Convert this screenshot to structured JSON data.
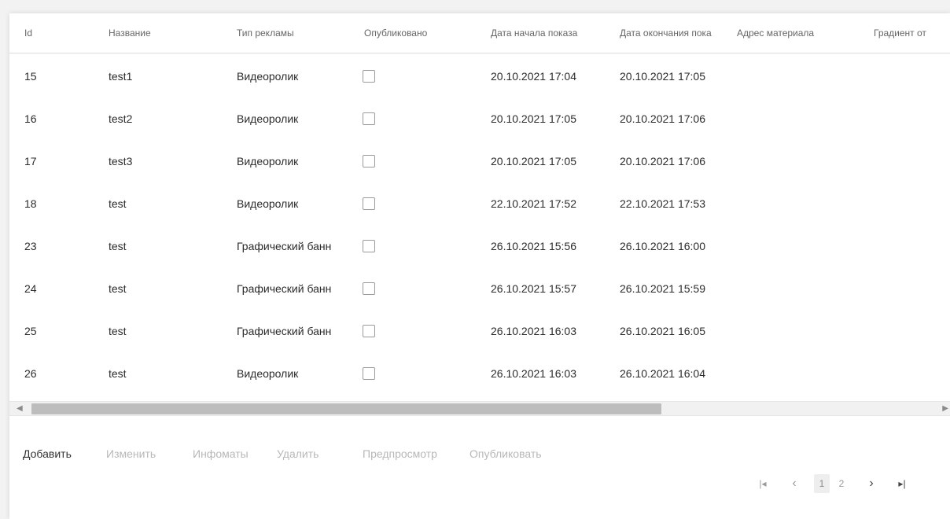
{
  "columns": [
    "Id",
    "Название",
    "Тип рекламы",
    "Опубликовано",
    "Дата начала показа",
    "Дата окончания пока",
    "Адрес материала",
    "Градиент от"
  ],
  "rows": [
    {
      "id": "15",
      "name": "test1",
      "type": "Видеоролик",
      "published": false,
      "start": "20.10.2021 17:04",
      "end": "20.10.2021 17:05",
      "address": "",
      "gradient": ""
    },
    {
      "id": "16",
      "name": "test2",
      "type": "Видеоролик",
      "published": false,
      "start": "20.10.2021 17:05",
      "end": "20.10.2021 17:06",
      "address": "",
      "gradient": ""
    },
    {
      "id": "17",
      "name": "test3",
      "type": "Видеоролик",
      "published": false,
      "start": "20.10.2021 17:05",
      "end": "20.10.2021 17:06",
      "address": "",
      "gradient": ""
    },
    {
      "id": "18",
      "name": "test",
      "type": "Видеоролик",
      "published": false,
      "start": "22.10.2021 17:52",
      "end": "22.10.2021 17:53",
      "address": "",
      "gradient": ""
    },
    {
      "id": "23",
      "name": "test",
      "type": "Графический банн",
      "published": false,
      "start": "26.10.2021 15:56",
      "end": "26.10.2021 16:00",
      "address": "",
      "gradient": ""
    },
    {
      "id": "24",
      "name": "test",
      "type": "Графический банн",
      "published": false,
      "start": "26.10.2021 15:57",
      "end": "26.10.2021 15:59",
      "address": "",
      "gradient": ""
    },
    {
      "id": "25",
      "name": "test",
      "type": "Графический банн",
      "published": false,
      "start": "26.10.2021 16:03",
      "end": "26.10.2021 16:05",
      "address": "",
      "gradient": ""
    },
    {
      "id": "26",
      "name": "test",
      "type": "Видеоролик",
      "published": false,
      "start": "26.10.2021 16:03",
      "end": "26.10.2021 16:04",
      "address": "",
      "gradient": ""
    }
  ],
  "scrollbar": {
    "left_arrow": "◀",
    "right_arrow": "▶"
  },
  "toolbar": [
    {
      "label": "Добавить",
      "enabled": true
    },
    {
      "label": "Изменить",
      "enabled": false
    },
    {
      "label": "Инфоматы",
      "enabled": false
    },
    {
      "label": "Удалить",
      "enabled": false
    },
    {
      "label": "Предпросмотр",
      "enabled": false
    },
    {
      "label": "Опубликовать",
      "enabled": false
    }
  ],
  "pager": {
    "first_icon": "first-page-icon",
    "prev_icon": "prev-page-icon",
    "pages": [
      "1",
      "2"
    ],
    "current_page": "1",
    "next_icon": "next-page-icon",
    "last_icon": "last-page-icon",
    "first_glyph": "|◂",
    "prev_glyph": "‹",
    "next_glyph": "›",
    "last_glyph": "▸|"
  }
}
